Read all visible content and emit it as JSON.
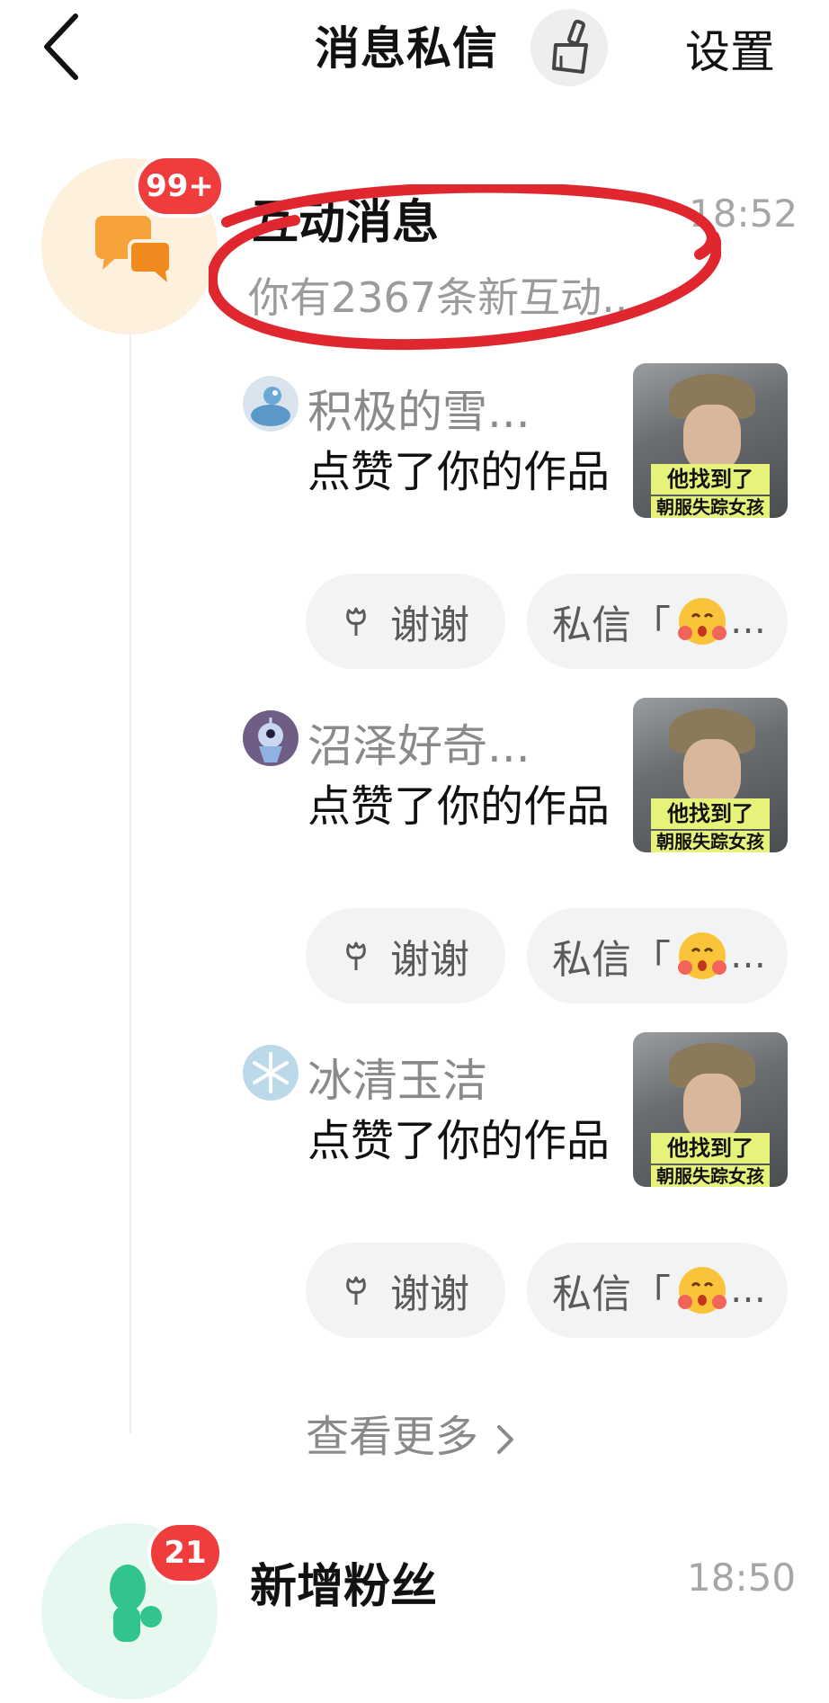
{
  "header": {
    "title": "消息私信",
    "settings_label": "设置",
    "back_icon": "chevron-left-icon",
    "clean_icon": "broom-icon"
  },
  "interaction": {
    "title": "互动消息",
    "badge": "99+",
    "time": "18:52",
    "summary": "你有2367条新互动...",
    "icon": "chat-bubbles-icon",
    "accent_color": "#f7a33b",
    "avatar_bg": "#fdf1de",
    "items": [
      {
        "user": "积极的雪...",
        "action": "点赞了你的作品",
        "thumb_caption": "他找到了",
        "thumb_caption2": "朝服失踪女孩",
        "thanks": "谢谢",
        "dm": "私信「",
        "avatar_color": "#d9e4ee"
      },
      {
        "user": "沼泽好奇...",
        "action": "点赞了你的作品",
        "thumb_caption": "他找到了",
        "thumb_caption2": "朝服失踪女孩",
        "thanks": "谢谢",
        "dm": "私信「",
        "avatar_color": "#6f5d86"
      },
      {
        "user": "冰清玉洁",
        "action": "点赞了你的作品",
        "thumb_caption": "他找到了",
        "thumb_caption2": "朝服失踪女孩",
        "thanks": "谢谢",
        "dm": "私信「",
        "avatar_color": "#bcd9ea"
      }
    ],
    "see_more": "查看更多"
  },
  "followers": {
    "title": "新增粉丝",
    "badge": "21",
    "time": "18:50",
    "icon": "person-icon",
    "accent_color": "#31c48d",
    "avatar_bg": "#e6f8ef"
  },
  "colors": {
    "badge_red": "#ef3d3d",
    "annotation_red": "#e0272f"
  }
}
